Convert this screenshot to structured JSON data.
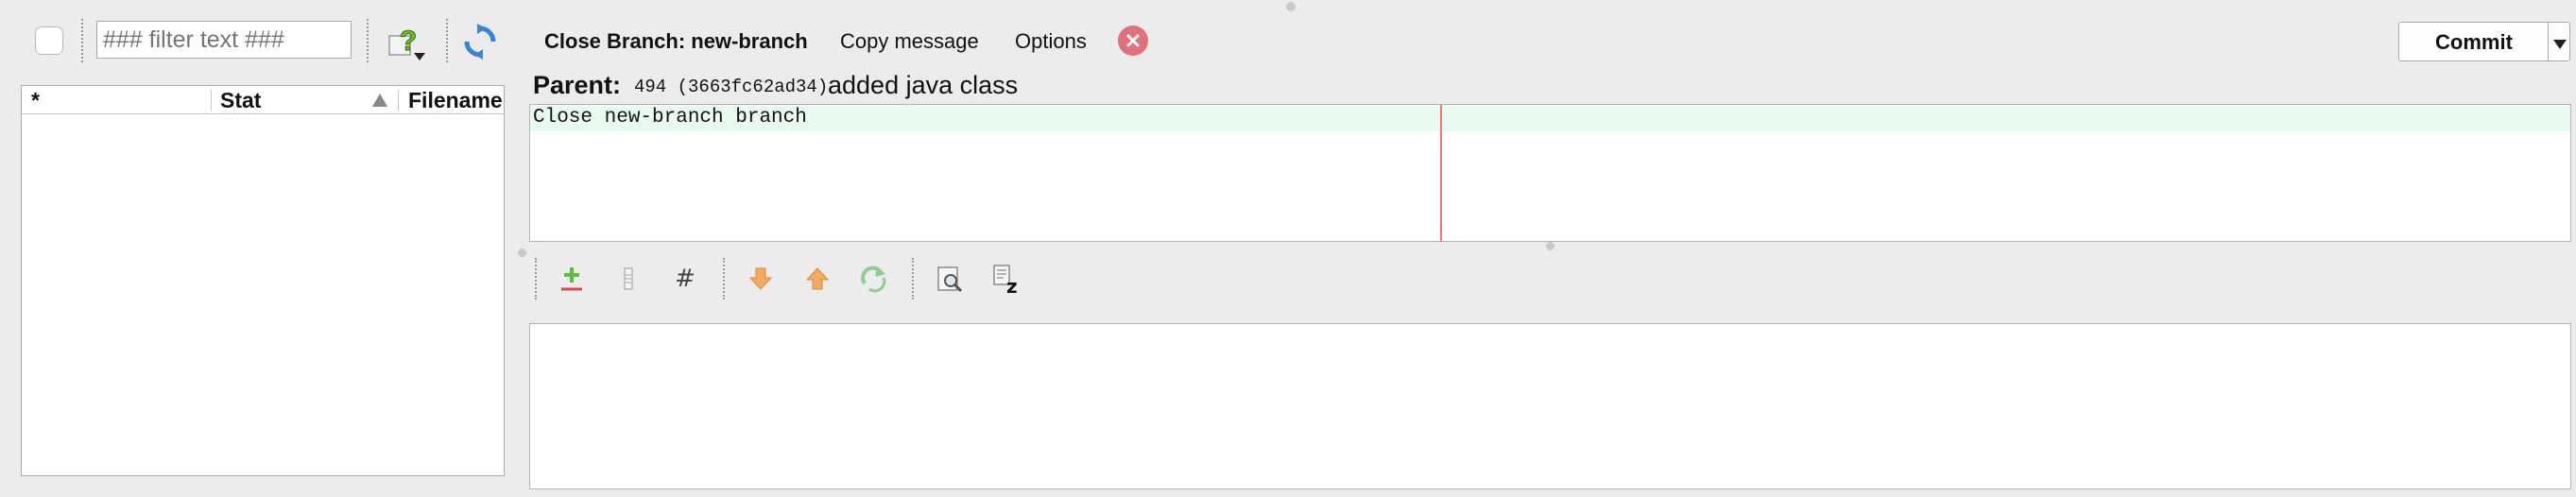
{
  "left_toolbar": {
    "filter_placeholder": "### filter text ###",
    "select_all_checked": false,
    "icons": [
      "select-all-checkbox",
      "unknown-files-icon",
      "refresh-icon"
    ]
  },
  "file_table": {
    "columns": [
      "*",
      "Stat",
      "Filename"
    ],
    "sort_column": "Stat",
    "sort_direction": "ascending",
    "rows": []
  },
  "actions": {
    "close_branch": "Close Branch: new-branch",
    "copy_message": "Copy message",
    "options": "Options",
    "commit": "Commit"
  },
  "parent": {
    "label": "Parent:",
    "revision": "494 (3663fc62ad34)",
    "summary": "added java class"
  },
  "message": {
    "lines": [
      "Close new-branch branch"
    ]
  },
  "diff_toolbar": {
    "icons": [
      "add-hunk-icon",
      "exclude-icon",
      "line-numbers-icon",
      "next-hunk-icon",
      "prev-hunk-icon",
      "refresh-diff-icon",
      "find-icon",
      "zoom-icon"
    ]
  },
  "colors": {
    "message_highlight": "#e8fbef",
    "margin_line": "#e87a6f",
    "close_icon": "#e0717a",
    "sort_arrow": "#888888"
  }
}
